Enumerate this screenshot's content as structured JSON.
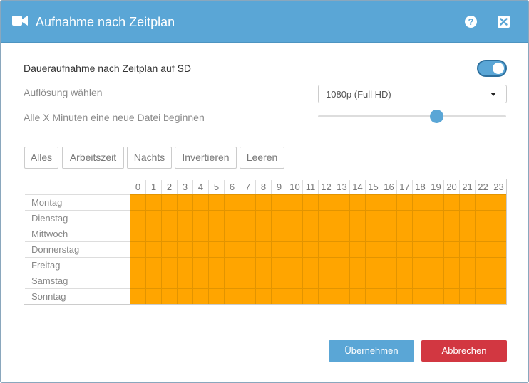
{
  "dialog": {
    "title": "Aufnahme nach Zeitplan",
    "title_icon": "video-camera-icon",
    "help_icon": "help-icon",
    "help_glyph": "?",
    "close_icon": "close-icon"
  },
  "settings": {
    "continuous_label": "Daueraufnahme nach Zeitplan auf SD",
    "continuous_enabled": true,
    "resolution_label": "Auflösung wählen",
    "resolution_value": "1080p (Full HD)",
    "interval_label": "Alle X Minuten eine neue Datei beginnen",
    "interval_slider_fraction": 0.63
  },
  "presets": [
    "Alles",
    "Arbeitszeit",
    "Nachts",
    "Invertieren",
    "Leeren"
  ],
  "schedule": {
    "hours": [
      "0",
      "1",
      "2",
      "3",
      "4",
      "5",
      "6",
      "7",
      "8",
      "9",
      "10",
      "11",
      "12",
      "13",
      "14",
      "15",
      "16",
      "17",
      "18",
      "19",
      "20",
      "21",
      "22",
      "23"
    ],
    "days": [
      "Montag",
      "Dienstag",
      "Mittwoch",
      "Donnerstag",
      "Freitag",
      "Samstag",
      "Sonntag"
    ],
    "all_active": true
  },
  "footer": {
    "accept_label": "Übernehmen",
    "cancel_label": "Abbrechen"
  },
  "colors": {
    "accent": "#5aa6d6",
    "active_cell": "#ffa500",
    "danger": "#d23741"
  }
}
